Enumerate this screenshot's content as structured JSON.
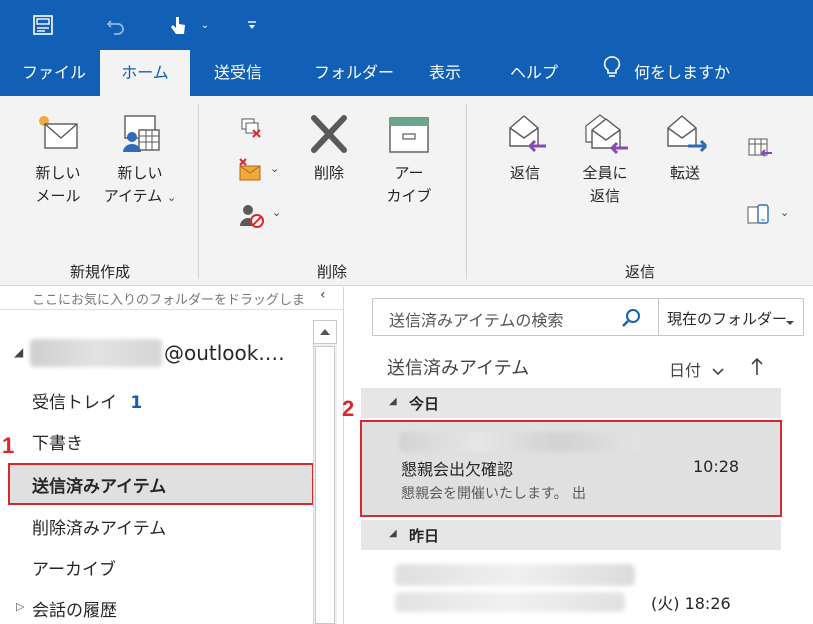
{
  "tabs": [
    "ファイル",
    "ホーム",
    "送受信",
    "フォルダー",
    "表示",
    "ヘルプ"
  ],
  "active_tab": "ホーム",
  "tell_me": "何をしますか",
  "ribbon": {
    "new_mail": [
      "新しい",
      "メール"
    ],
    "new_items": [
      "新しい",
      "アイテム"
    ],
    "new_group_label": "新規作成",
    "delete": "削除",
    "archive": [
      "アー",
      "カイブ"
    ],
    "delete_group_label": "削除",
    "reply": "返信",
    "reply_all": [
      "全員に",
      "返信"
    ],
    "forward": "転送",
    "respond_group_label": "返信"
  },
  "left": {
    "favorites_hint": "ここにお気に入りのフォルダーをドラッグしま",
    "account_suffix": "@outlook.…",
    "folders": [
      {
        "name": "受信トレイ",
        "count": "1"
      },
      {
        "name": "下書き"
      },
      {
        "name": "送信済みアイテム"
      },
      {
        "name": "削除済みアイテム"
      },
      {
        "name": "アーカイブ"
      },
      {
        "name": "会話の履歴"
      }
    ]
  },
  "search": {
    "placeholder": "送信済みアイテムの検索",
    "scope": "現在のフォルダー"
  },
  "list": {
    "title": "送信済みアイテム",
    "sort_label": "日付",
    "groups": [
      {
        "label": "今日",
        "messages": [
          {
            "subject": "懇親会出欠確認",
            "time": "10:28",
            "preview": "懇親会を開催いたします。 出"
          }
        ]
      },
      {
        "label": "昨日",
        "messages": [
          {
            "time": "(火) 18:26"
          }
        ]
      }
    ]
  },
  "annotations": [
    "1",
    "2"
  ],
  "colors": {
    "brand_blue": "#1160b6",
    "ribbon_bg": "#f3f3f3",
    "highlight": "#d9272e",
    "selected_bg": "#e0e0e0",
    "unread_blue": "#1160b6"
  }
}
